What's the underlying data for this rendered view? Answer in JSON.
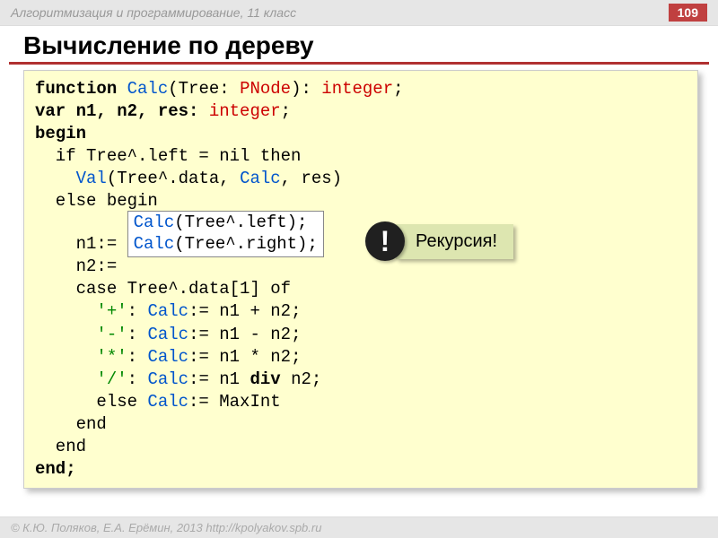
{
  "header": {
    "course": "Алгоритмизация и программирование, 11 класс",
    "page": "109"
  },
  "title": "Вычисление по дереву",
  "code": {
    "l1_a": "function ",
    "l1_b": "Calc",
    "l1_c": "(Tree: ",
    "l1_d": "PNode",
    "l1_e": "): ",
    "l1_f": "integer",
    "l1_g": ";",
    "l2_a": "var n1, n2, res: ",
    "l2_b": "integer",
    "l2_c": ";",
    "l3": "begin",
    "l4": "  if Tree^.left = nil then",
    "l5_a": "    ",
    "l5_b": "Val",
    "l5_c": "(Tree^.data, ",
    "l5_d": "Calc",
    "l5_e": ", res)",
    "l6": "  else begin",
    "box_l1_a": "n1:= ",
    "box_l1_b": "Calc",
    "box_l1_c": "(Tree^.left);",
    "box_l2_a": "n2:= ",
    "box_l2_b": "Calc",
    "box_l2_c": "(Tree^.right);",
    "l9": "    case Tree^.data[1] of",
    "l10_a": "      ",
    "l10_b": "'+'",
    "l10_c": ": ",
    "l10_d": "Calc",
    "l10_e": ":= n1 + n2;",
    "l11_a": "      ",
    "l11_b": "'-'",
    "l11_c": ": ",
    "l11_d": "Calc",
    "l11_e": ":= n1 - n2;",
    "l12_a": "      ",
    "l12_b": "'*'",
    "l12_c": ": ",
    "l12_d": "Calc",
    "l12_e": ":= n1 * n2;",
    "l13_a": "      ",
    "l13_b": "'/'",
    "l13_c": ": ",
    "l13_d": "Calc",
    "l13_e": ":= n1 ",
    "l13_f": "div",
    "l13_g": " n2;",
    "l14_a": "      else ",
    "l14_b": "Calc",
    "l14_c": ":= MaxInt",
    "l15": "    end",
    "l16": "  end",
    "l17": "end;"
  },
  "callout": {
    "bang": "!",
    "label": "Рекурсия!"
  },
  "footer": "© К.Ю. Поляков, Е.А. Ерёмин, 2013     http://kpolyakov.spb.ru"
}
